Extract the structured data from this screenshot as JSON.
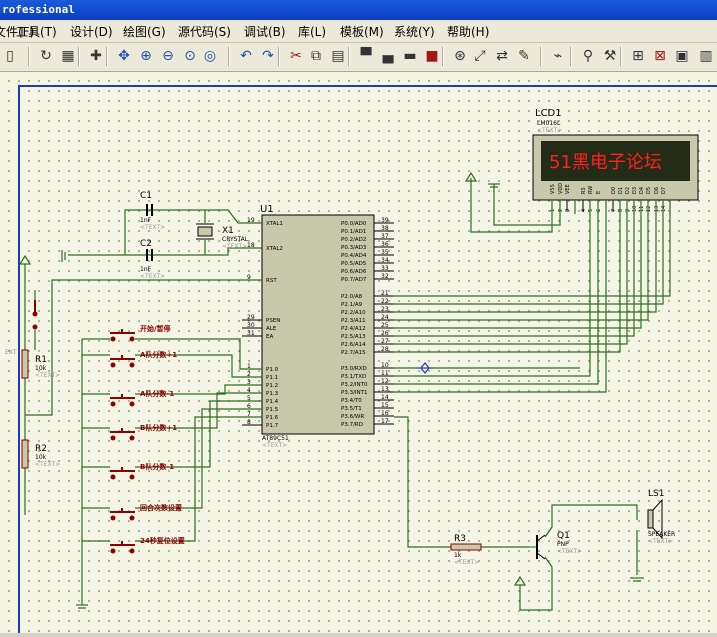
{
  "window": {
    "title": "rofessional"
  },
  "menu": [
    "文件(F)",
    "工具(T)",
    "设计(D)",
    "绘图(G)",
    "源代码(S)",
    "调试(B)",
    "库(L)",
    "模板(M)",
    "系统(Y)",
    "帮助(H)"
  ],
  "toolbar_icons": [
    "new-doc-icon",
    "refresh-icon",
    "grid-icon",
    "origin-icon",
    "pan-icon",
    "zoom-in-icon",
    "zoom-out-icon",
    "zoom-all-icon",
    "zoom-area-icon",
    "undo-icon",
    "redo-icon",
    "cut-icon",
    "copy-icon",
    "paste-icon",
    "block-copy-icon",
    "block-move-icon",
    "block-rotate-icon",
    "block-delete-icon",
    "pick-device-icon",
    "make-device-icon",
    "package-tool-icon",
    "decompose-icon",
    "wire-autoroute-icon",
    "search-icon",
    "property-icon",
    "new-sheet-icon",
    "remove-sheet-icon",
    "exit-parent-icon",
    "bom-icon"
  ],
  "schematic": {
    "lcd": {
      "ref": "LCD1",
      "part": "LM016L",
      "text_tag": "<TEXT>",
      "display": "51黑电子论坛",
      "pins": [
        "VSS",
        "VDD",
        "VEE",
        "RS",
        "RW",
        "E",
        "D0",
        "D1",
        "D2",
        "D3",
        "D4",
        "D5",
        "D6",
        "D7"
      ],
      "pin_nums": [
        "1",
        "2",
        "3",
        "4",
        "5",
        "6",
        "7",
        "8",
        "9",
        "10",
        "11",
        "12",
        "13",
        "14"
      ]
    },
    "mcu": {
      "ref": "U1",
      "part": "AT89C51",
      "text_tag": "<TEXT>",
      "left_pins": [
        [
          "19",
          "XTAL1"
        ],
        [
          "18",
          "XTAL2"
        ],
        [
          "9",
          "RST"
        ],
        [
          "29",
          "PSEN"
        ],
        [
          "30",
          "ALE"
        ],
        [
          "31",
          "EA"
        ],
        [
          "1",
          "P1.0"
        ],
        [
          "2",
          "P1.1"
        ],
        [
          "3",
          "P1.2"
        ],
        [
          "4",
          "P1.3"
        ],
        [
          "5",
          "P1.4"
        ],
        [
          "6",
          "P1.5"
        ],
        [
          "7",
          "P1.6"
        ],
        [
          "8",
          "P1.7"
        ]
      ],
      "right_p0": [
        [
          "39",
          "P0.0/AD0"
        ],
        [
          "38",
          "P0.1/AD1"
        ],
        [
          "37",
          "P0.2/AD2"
        ],
        [
          "36",
          "P0.3/AD3"
        ],
        [
          "35",
          "P0.4/AD4"
        ],
        [
          "34",
          "P0.5/AD5"
        ],
        [
          "33",
          "P0.6/AD6"
        ],
        [
          "32",
          "P0.7/AD7"
        ]
      ],
      "right_p2": [
        [
          "21",
          "P2.0/A8"
        ],
        [
          "22",
          "P2.1/A9"
        ],
        [
          "23",
          "P2.2/A10"
        ],
        [
          "24",
          "P2.3/A11"
        ],
        [
          "25",
          "P2.4/A12"
        ],
        [
          "26",
          "P2.5/A13"
        ],
        [
          "27",
          "P2.6/A14"
        ],
        [
          "28",
          "P2.7/A15"
        ]
      ],
      "right_p3": [
        [
          "10",
          "P3.0/RXD"
        ],
        [
          "11",
          "P3.1/TXD"
        ],
        [
          "12",
          "P3.2/INT0"
        ],
        [
          "13",
          "P3.3/INT1"
        ],
        [
          "14",
          "P3.4/T0"
        ],
        [
          "15",
          "P3.5/T1"
        ],
        [
          "16",
          "P3.6/WR"
        ],
        [
          "17",
          "P3.7/RD"
        ]
      ]
    },
    "c1": {
      "ref": "C1",
      "value": "1nF",
      "text_tag": "<TEXT>"
    },
    "c2": {
      "ref": "C2",
      "value": "1nF",
      "text_tag": "<TEXT>"
    },
    "x1": {
      "ref": "X1",
      "value": "CRYSTAL",
      "text_tag": "<TEXT>"
    },
    "r1": {
      "ref": "R1",
      "value": "10k",
      "text_tag": "<TEXT>"
    },
    "r2": {
      "ref": "R2",
      "value": "10k",
      "text_tag": "<TEXT>"
    },
    "r3": {
      "ref": "R3",
      "value": "1k",
      "text_tag": "<TEXT>"
    },
    "q1": {
      "ref": "Q1",
      "value": "PNP",
      "text_tag": "<TEXT>"
    },
    "ls1": {
      "ref": "LS1",
      "value": "SPEAKER",
      "text_tag": "<TEXT>"
    },
    "left_stub": "EXT",
    "buttons": [
      "开始/暂停",
      "A队分数+1",
      "A队分数-1",
      "B队分数+1",
      "B队分数-1",
      "回合次数设置",
      "24秒复位设置"
    ]
  },
  "colors": {
    "wire": "#2c6d20",
    "component": "#8b0000",
    "body": "#c8c8aa",
    "border": "#1f3bb0",
    "lcd_bg": "#222c17",
    "lcd_text": "#ff2020"
  }
}
